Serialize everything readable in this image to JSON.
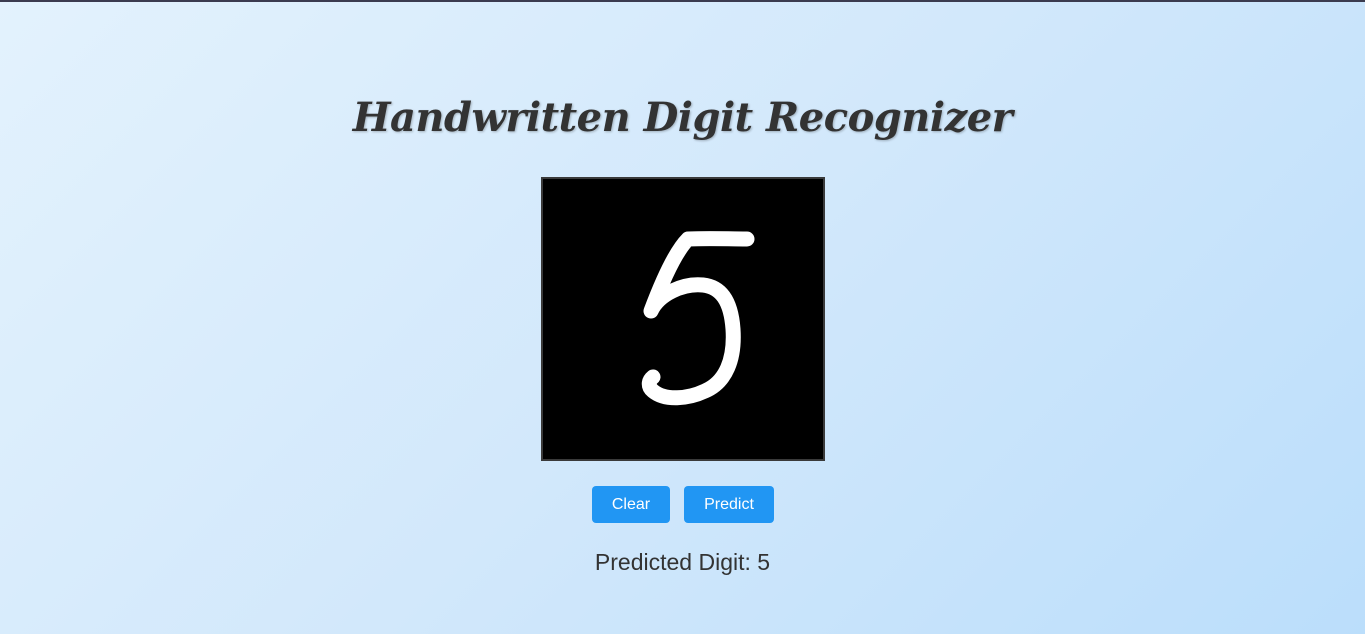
{
  "page": {
    "title": "Handwritten Digit Recognizer"
  },
  "canvas": {
    "background_color": "#000000",
    "stroke_color": "#ffffff",
    "drawn_digit": "5"
  },
  "buttons": {
    "clear_label": "Clear",
    "predict_label": "Predict",
    "color": "#2196f3"
  },
  "result": {
    "text": "Predicted Digit: 5"
  }
}
